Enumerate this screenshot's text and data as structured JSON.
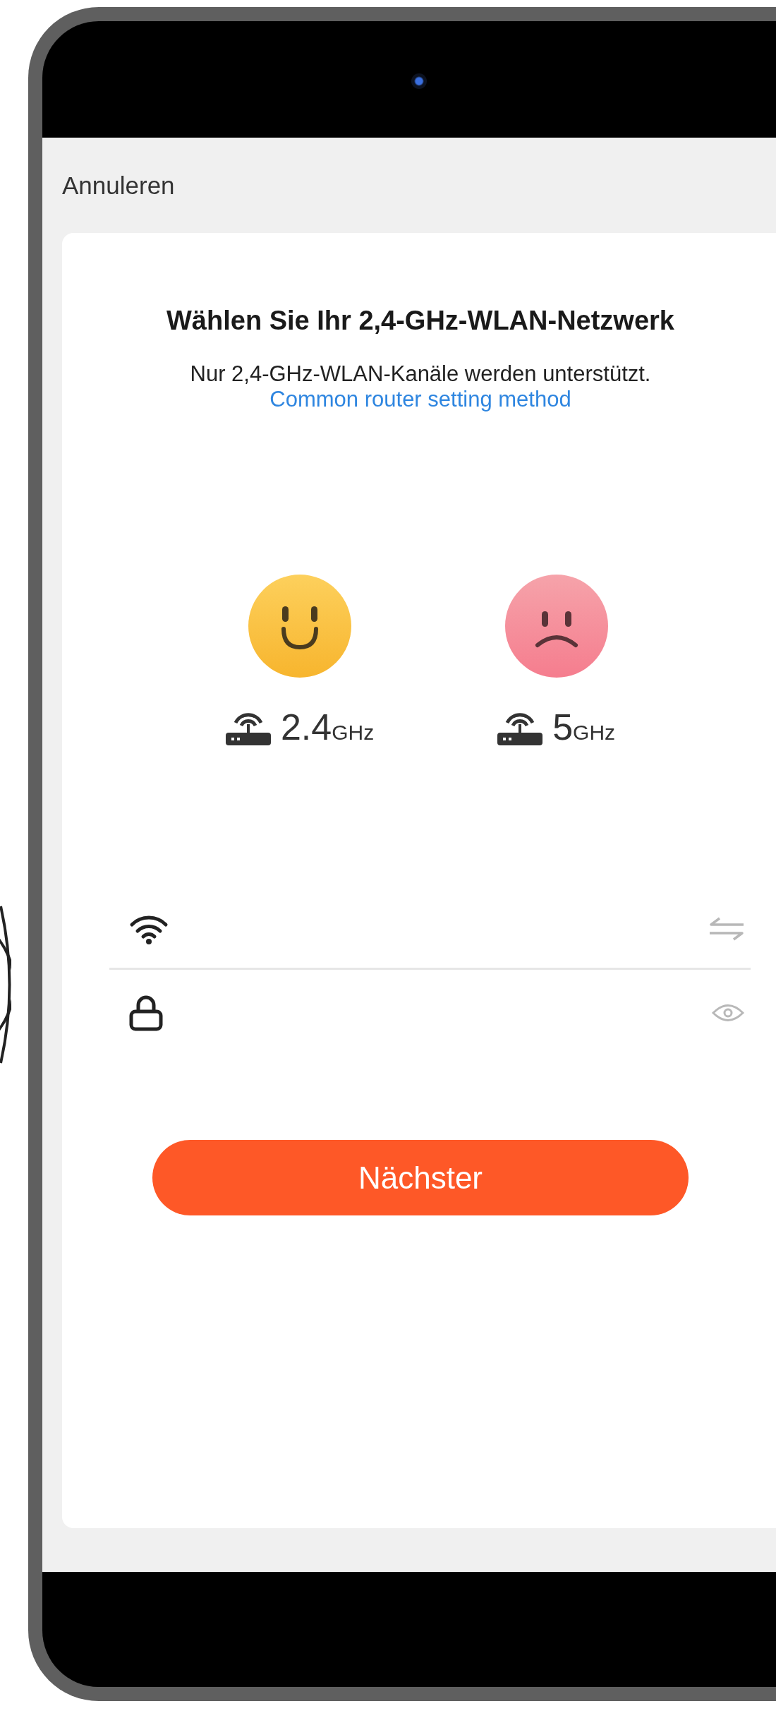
{
  "header": {
    "cancel": "Annuleren"
  },
  "card": {
    "title": "Wählen Sie Ihr 2,4-GHz-WLAN-Netzwerk",
    "subtitle": "Nur 2,4-GHz-WLAN-Kanäle werden unterstützt.",
    "link": "Common router setting method"
  },
  "bands": [
    {
      "kind": "happy",
      "number": "2.4",
      "unit": "GHz"
    },
    {
      "kind": "sad",
      "number": "5",
      "unit": "GHz"
    }
  ],
  "fields": [
    {
      "kind": "network"
    },
    {
      "kind": "password"
    }
  ],
  "next_button": "Nächster"
}
